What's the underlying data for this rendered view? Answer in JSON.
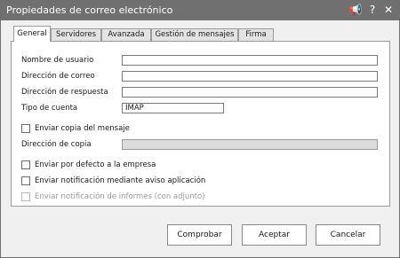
{
  "window": {
    "title": "Propiedades de correo electrónico"
  },
  "titlebar_icons": [
    "megaphone-icon",
    "help-icon",
    "close-icon"
  ],
  "titlebar_glyphs": {
    "megaphone": "📢",
    "help": "?",
    "close": "✕"
  },
  "tabs": [
    {
      "label": "General",
      "active": true
    },
    {
      "label": "Servidores",
      "active": false
    },
    {
      "label": "Avanzada",
      "active": false
    },
    {
      "label": "Gestión de mensajes",
      "active": false
    },
    {
      "label": "Firma",
      "active": false
    }
  ],
  "form": {
    "username_label": "Nombre de usuario",
    "username_value": "",
    "email_label": "Dirección de correo",
    "email_value": "",
    "reply_label": "Dirección de respuesta",
    "reply_value": "",
    "account_type_label": "Tipo de cuenta",
    "account_type_value": "IMAP",
    "send_copy_label": "Enviar copia del mensaje",
    "send_copy_checked": false,
    "copy_address_label": "Dirección de copia",
    "copy_address_value": "",
    "default_company_label": "Enviar por defecto a la empresa",
    "default_company_checked": false,
    "notify_app_label": "Enviar notificación mediante aviso aplicación",
    "notify_app_checked": false,
    "notify_report_label": "Enviar notificación de informes (con adjunto)",
    "notify_report_checked": false
  },
  "buttons": {
    "check": "Comprobar",
    "accept": "Aceptar",
    "cancel": "Cancelar"
  },
  "colors": {
    "titlebar": "#707070",
    "window_bg": "#f0f0f0",
    "panel_bg": "#ffffff",
    "disabled_field": "#dcdcdc",
    "disabled_text": "#9a9a9a"
  }
}
